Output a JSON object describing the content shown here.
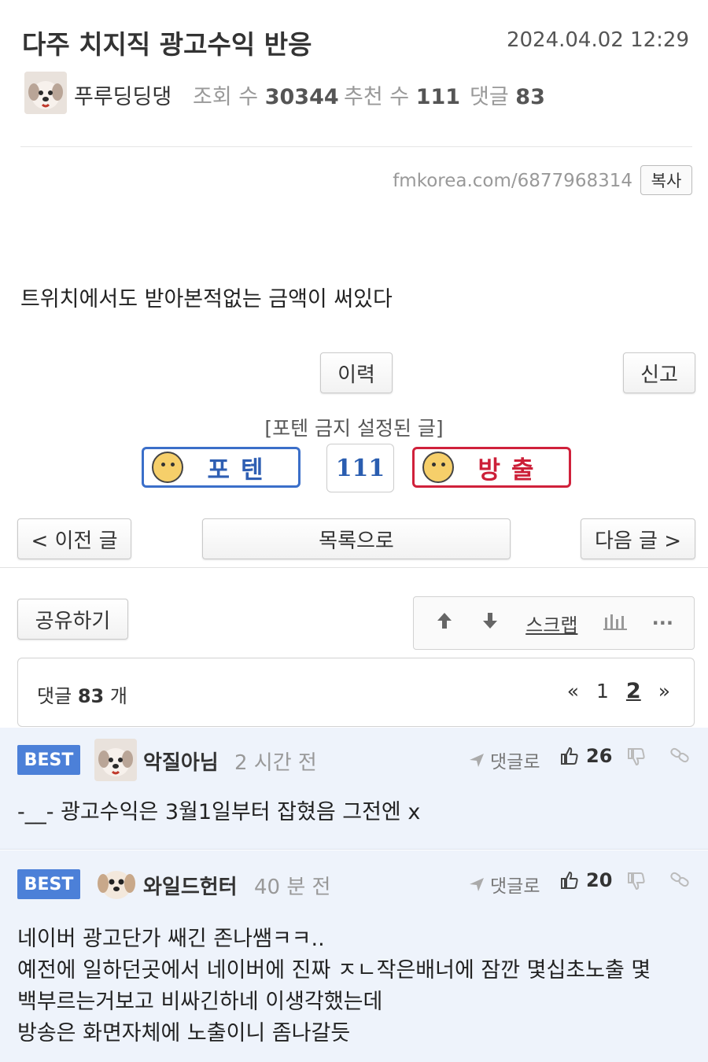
{
  "post": {
    "title": "다주 치지직 광고수익 반응",
    "date": "2024.04.02 12:29",
    "author": "푸루딩딩댕",
    "views_label": "조회 수",
    "views": "30344",
    "recommend_label": "추천 수",
    "recommend": "111",
    "comments_label": "댓글",
    "comments": "83",
    "url": "fmkorea.com/6877968314",
    "copy_label": "복사",
    "body": "트위치에서도 받아본적없는 금액이 써있다"
  },
  "actions": {
    "history_label": "이력",
    "report_label": "신고",
    "vote_notice": "[포텐 금지 설정된 글]",
    "upvote_label": "포텐",
    "vote_count": "111",
    "downvote_label": "방출",
    "prev_label": "< 이전 글",
    "list_label": "목록으로",
    "next_label": "다음 글 >",
    "share_label": "공유하기",
    "scrap_label": "스크랩",
    "more_label": "···"
  },
  "comment_section": {
    "count_label": "댓글",
    "count": "83",
    "count_unit": "개",
    "pages": {
      "first": "«",
      "page1": "1",
      "page2": "2",
      "last": "»"
    }
  },
  "comments": [
    {
      "badge": "BEST",
      "nick": "악질아님",
      "time": "2 시간 전",
      "reply_label": "댓글로",
      "likes": "26",
      "lines": [
        "-__- 광고수익은 3월1일부터 잡혔음 그전엔 x"
      ]
    },
    {
      "badge": "BEST",
      "nick": "와일드헌터",
      "time": "40 분 전",
      "reply_label": "댓글로",
      "likes": "20",
      "lines": [
        "네이버 광고단가 쌔긴 존나쌤ㅋㅋ..",
        "예전에 일하던곳에서 네이버에 진짜 ㅈㄴ작은배너에 잠깐 몇십초노출 몇",
        "백부르는거보고 비싸긴하네 이생각했는데",
        "방송은 화면자체에 노출이니 좀나갈듯"
      ]
    }
  ]
}
